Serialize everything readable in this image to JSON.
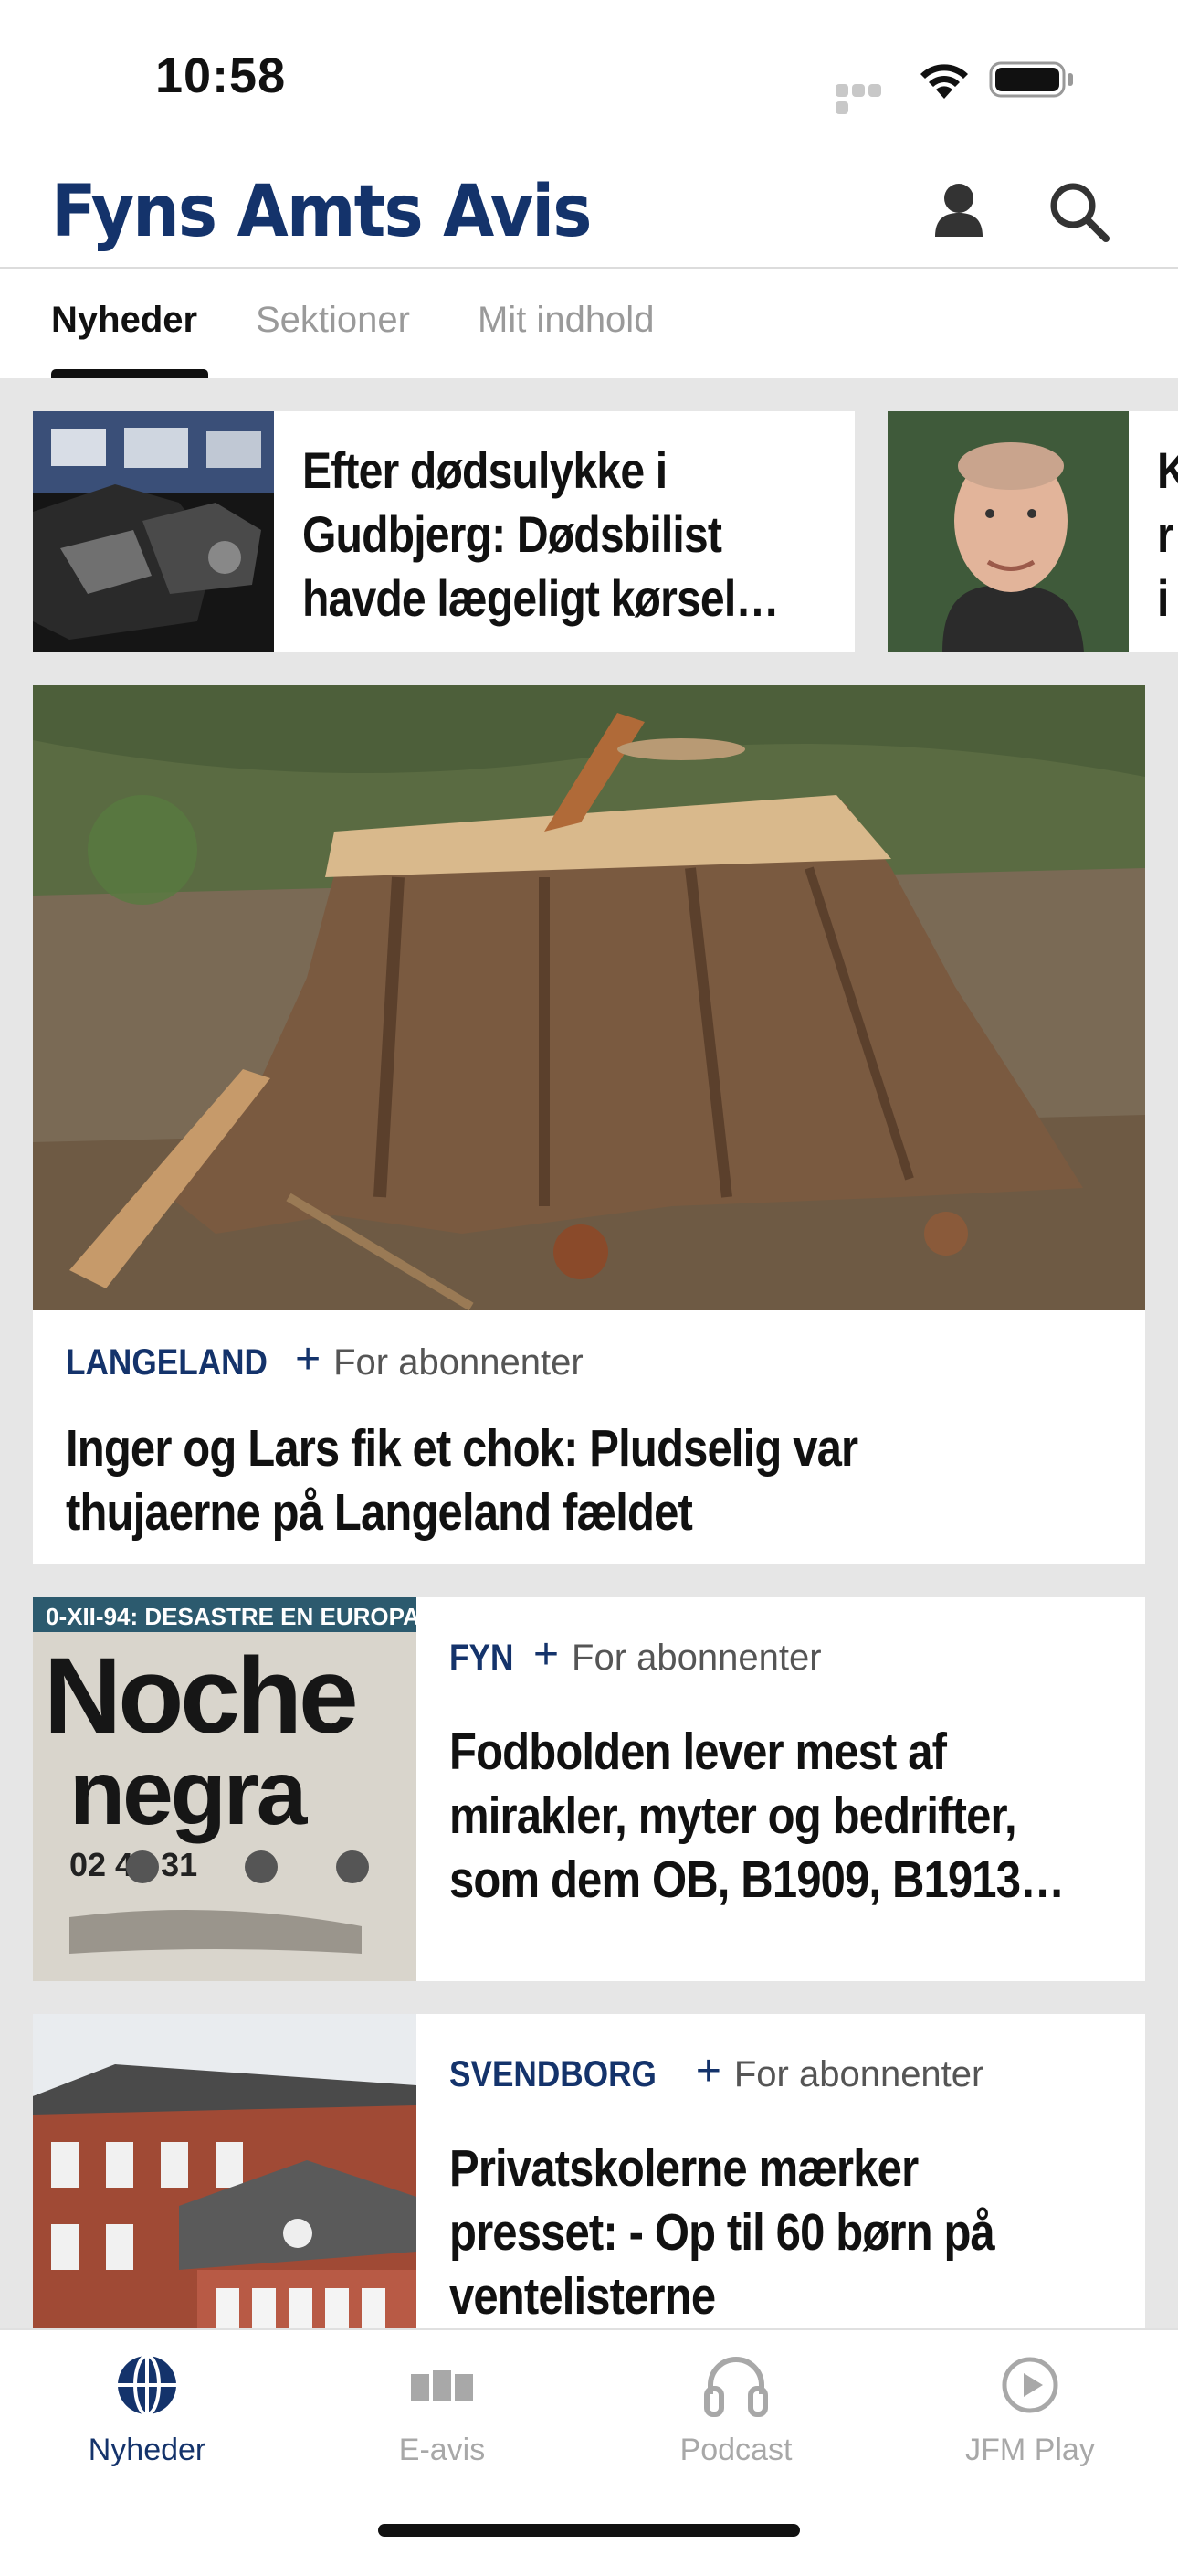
{
  "status_bar": {
    "time": "10:58"
  },
  "header": {
    "logo": "Fyns Amts Avis"
  },
  "tabs": [
    {
      "label": "Nyheder",
      "active": true
    },
    {
      "label": "Sektioner",
      "active": false
    },
    {
      "label": "Mit indhold",
      "active": false
    }
  ],
  "top_stories": [
    {
      "title_lines": [
        "Efter dødsulykke i",
        "Gudbjerg: Dødsbilist",
        "havde lægeligt kørsel…"
      ]
    },
    {
      "title_lines": [
        "K",
        "r",
        "i"
      ]
    }
  ],
  "featured": {
    "section": "LANGELAND",
    "plus": "+",
    "subscriber_label": "For abonnenter",
    "title_lines": [
      "Inger og Lars fik et chok: Pludselig var",
      "thujaerne på Langeland fældet"
    ]
  },
  "articles": [
    {
      "section": "FYN",
      "plus": "+",
      "subscriber_label": "For abonnenter",
      "title_lines": [
        "Fodbolden lever mest af",
        "mirakler, myter og bedrifter,",
        "som dem OB, B1909, B1913…"
      ],
      "thumb_text": {
        "banner": "0-XII-94: DESASTRE EN EUROPA",
        "word1": "Noche",
        "word2": "negra",
        "scores": "02  42  31"
      }
    },
    {
      "section": "SVENDBORG",
      "plus": "+",
      "subscriber_label": "For abonnenter",
      "title_lines": [
        "Privatskolerne mærker",
        "presset: - Op til 60 børn på",
        "ventelisterne"
      ]
    }
  ],
  "bottom_nav": [
    {
      "label": "Nyheder",
      "icon": "globe-icon",
      "active": true
    },
    {
      "label": "E-avis",
      "icon": "newspaper-icon",
      "active": false
    },
    {
      "label": "Podcast",
      "icon": "headphones-icon",
      "active": false
    },
    {
      "label": "JFM Play",
      "icon": "play-icon",
      "active": false
    }
  ],
  "colors": {
    "brand": "#14336b",
    "inactive": "#a8a8a8",
    "background": "#e6e6e6"
  }
}
